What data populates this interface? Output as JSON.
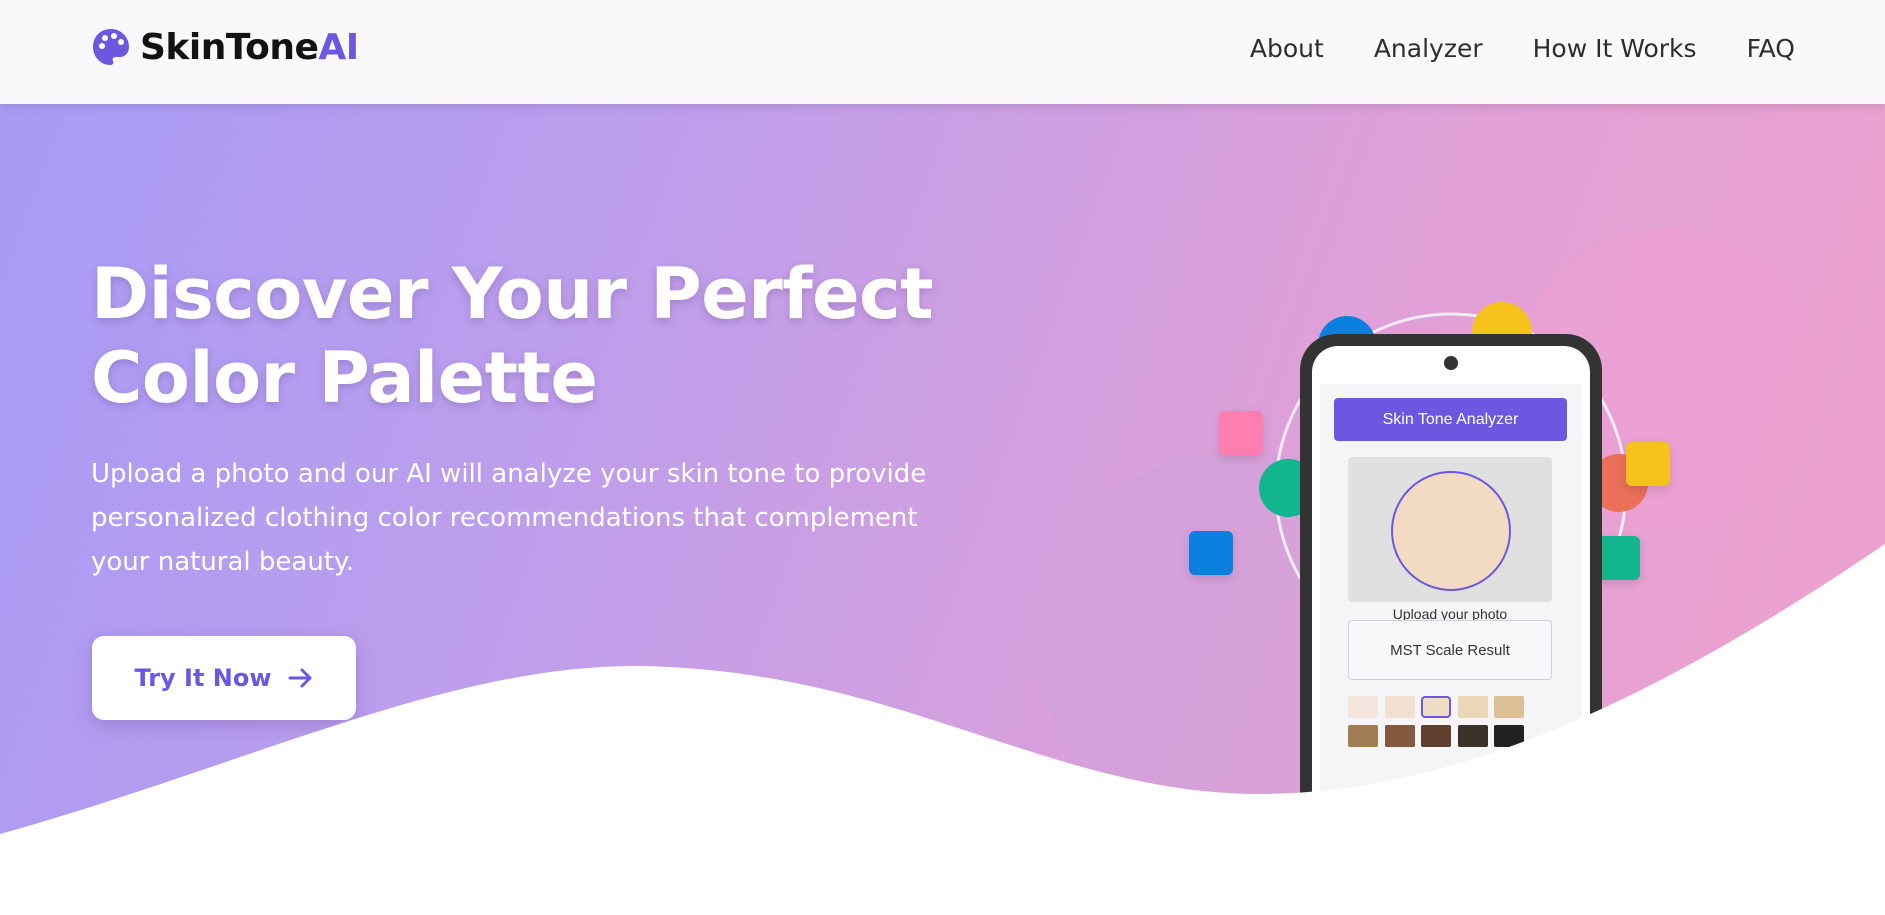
{
  "header": {
    "logo_text": "SkinTone",
    "logo_accent": "AI",
    "logo_icon": "palette-icon",
    "nav": [
      {
        "label": "About"
      },
      {
        "label": "Analyzer"
      },
      {
        "label": "How It Works"
      },
      {
        "label": "FAQ"
      }
    ]
  },
  "hero": {
    "headline_line1": "Discover Your Perfect",
    "headline_line2": "Color Palette",
    "subtitle": "Upload a photo and our AI will analyze your skin tone to provide personalized clothing color recommendations that complement your natural beauty.",
    "cta_label": "Try It Now",
    "cta_icon": "arrow-right-icon"
  },
  "phone": {
    "analyzer_button": "Skin Tone Analyzer",
    "upload_label": "Upload your photo",
    "result_label": "MST Scale Result",
    "swatches_row1": [
      "#f4e6dc",
      "#f2e1d2",
      "#efdcc4",
      "#ecd6b8",
      "#dec096"
    ],
    "swatches_row2": [
      "#a07c52",
      "#84593e",
      "#5f3f2e",
      "#3c3128",
      "#222222"
    ],
    "selected_swatch_index": 2
  },
  "colors": {
    "accent": "#6b57e0",
    "deco_pink": "#ff7eb0",
    "deco_green": "#12b58e",
    "deco_blue": "#0b7fe0",
    "deco_yellow": "#f4c21b",
    "deco_orange": "#ea7059"
  }
}
